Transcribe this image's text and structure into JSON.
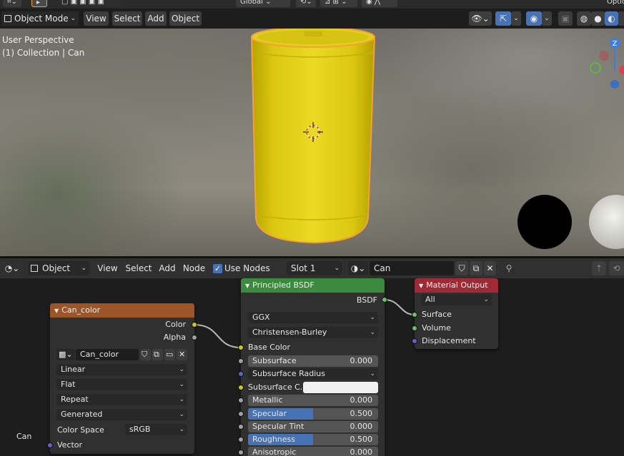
{
  "top_header": {
    "mode_dropdown": "Object Mode",
    "menu": [
      "View",
      "Select",
      "Add",
      "Object"
    ],
    "transform_orientation": "Global",
    "top_right_text": "Optio"
  },
  "viewport": {
    "overlay_line1": "User Perspective",
    "overlay_line2": "(1) Collection | Can",
    "gizmo_axis_label": "Z"
  },
  "node_header": {
    "object_dropdown": "Object",
    "menu": [
      "View",
      "Select",
      "Add",
      "Node"
    ],
    "use_nodes_label": "Use Nodes",
    "slot": "Slot 1",
    "material_name": "Can"
  },
  "nodes": {
    "image_texture": {
      "title": "Can_color",
      "outputs": [
        "Color",
        "Alpha"
      ],
      "image_name": "Can_color",
      "interpolation": "Linear",
      "projection": "Flat",
      "extension": "Repeat",
      "source": "Generated",
      "color_space_label": "Color Space",
      "color_space": "sRGB",
      "input": "Vector",
      "header_color": "#9b5528"
    },
    "principled": {
      "title": "Principled BSDF",
      "output": "BSDF",
      "distribution": "GGX",
      "subsurface_method": "Christensen-Burley",
      "base_color_label": "Base Color",
      "subsurface_label": "Subsurface",
      "subsurface_value": "0.000",
      "subsurface_radius_label": "Subsurface Radius",
      "subsurface_color_label": "Subsurface C...",
      "metallic_label": "Metallic",
      "metallic_value": "0.000",
      "specular_label": "Specular",
      "specular_value": "0.500",
      "specular_fill": 0.5,
      "specular_tint_label": "Specular Tint",
      "specular_tint_value": "0.000",
      "roughness_label": "Roughness",
      "roughness_value": "0.500",
      "roughness_fill": 0.5,
      "anisotropic_label": "Anisotropic",
      "anisotropic_value": "0.000",
      "header_color": "#3c8a3e"
    },
    "material_output": {
      "title": "Material Output",
      "target": "All",
      "inputs": [
        "Surface",
        "Volume",
        "Displacement"
      ],
      "header_color": "#9e2a35"
    }
  },
  "frame_label": "Can",
  "colors": {
    "can_yellow": "#e8d51a",
    "selection_outline": "#f5a03a",
    "socket_yellow": "#c7c729",
    "socket_gray": "#a1a1a1",
    "socket_blue": "#6363c7",
    "socket_green": "#63c763"
  }
}
